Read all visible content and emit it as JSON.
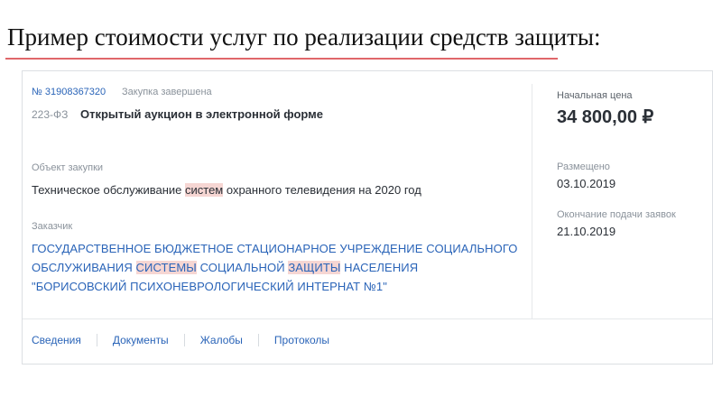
{
  "slide": {
    "title": "Пример стоимости услуг по реализации средств защиты:"
  },
  "procurement": {
    "number": "№ 31908367320",
    "status": "Закупка завершена",
    "law": "223-ФЗ",
    "method": "Открытый аукцион в электронной форме",
    "object_label": "Объект закупки",
    "object_parts": [
      "Техническое обслуживание ",
      "систем",
      " охранного телевидения на 2020 год"
    ],
    "customer_label": "Заказчик",
    "customer_line1": "ГОСУДАРСТВЕННОЕ БЮДЖЕТНОЕ СТАЦИОНАРНОЕ УЧРЕЖДЕНИЕ СОЦИАЛЬНОГО",
    "customer_line2_parts": [
      "ОБСЛУЖИВАНИЯ ",
      "СИСТЕМЫ",
      " СОЦИАЛЬНОЙ ",
      "ЗАЩИТЫ",
      " НАСЕЛЕНИЯ"
    ],
    "customer_line3": "\"БОРИСОВСКИЙ ПСИХОНЕВРОЛОГИЧЕСКИЙ ИНТЕРНАТ №1\"",
    "price_label": "Начальная цена",
    "price_value": "34 800,00 ₽",
    "posted_label": "Размещено",
    "posted_value": "03.10.2019",
    "deadline_label": "Окончание подачи заявок",
    "deadline_value": "21.10.2019"
  },
  "tabs": [
    "Сведения",
    "Документы",
    "Жалобы",
    "Протоколы"
  ],
  "colors": {
    "accent_link": "#2a64b8",
    "highlight": "#f6d6d3",
    "title_underline": "#e0676a"
  }
}
